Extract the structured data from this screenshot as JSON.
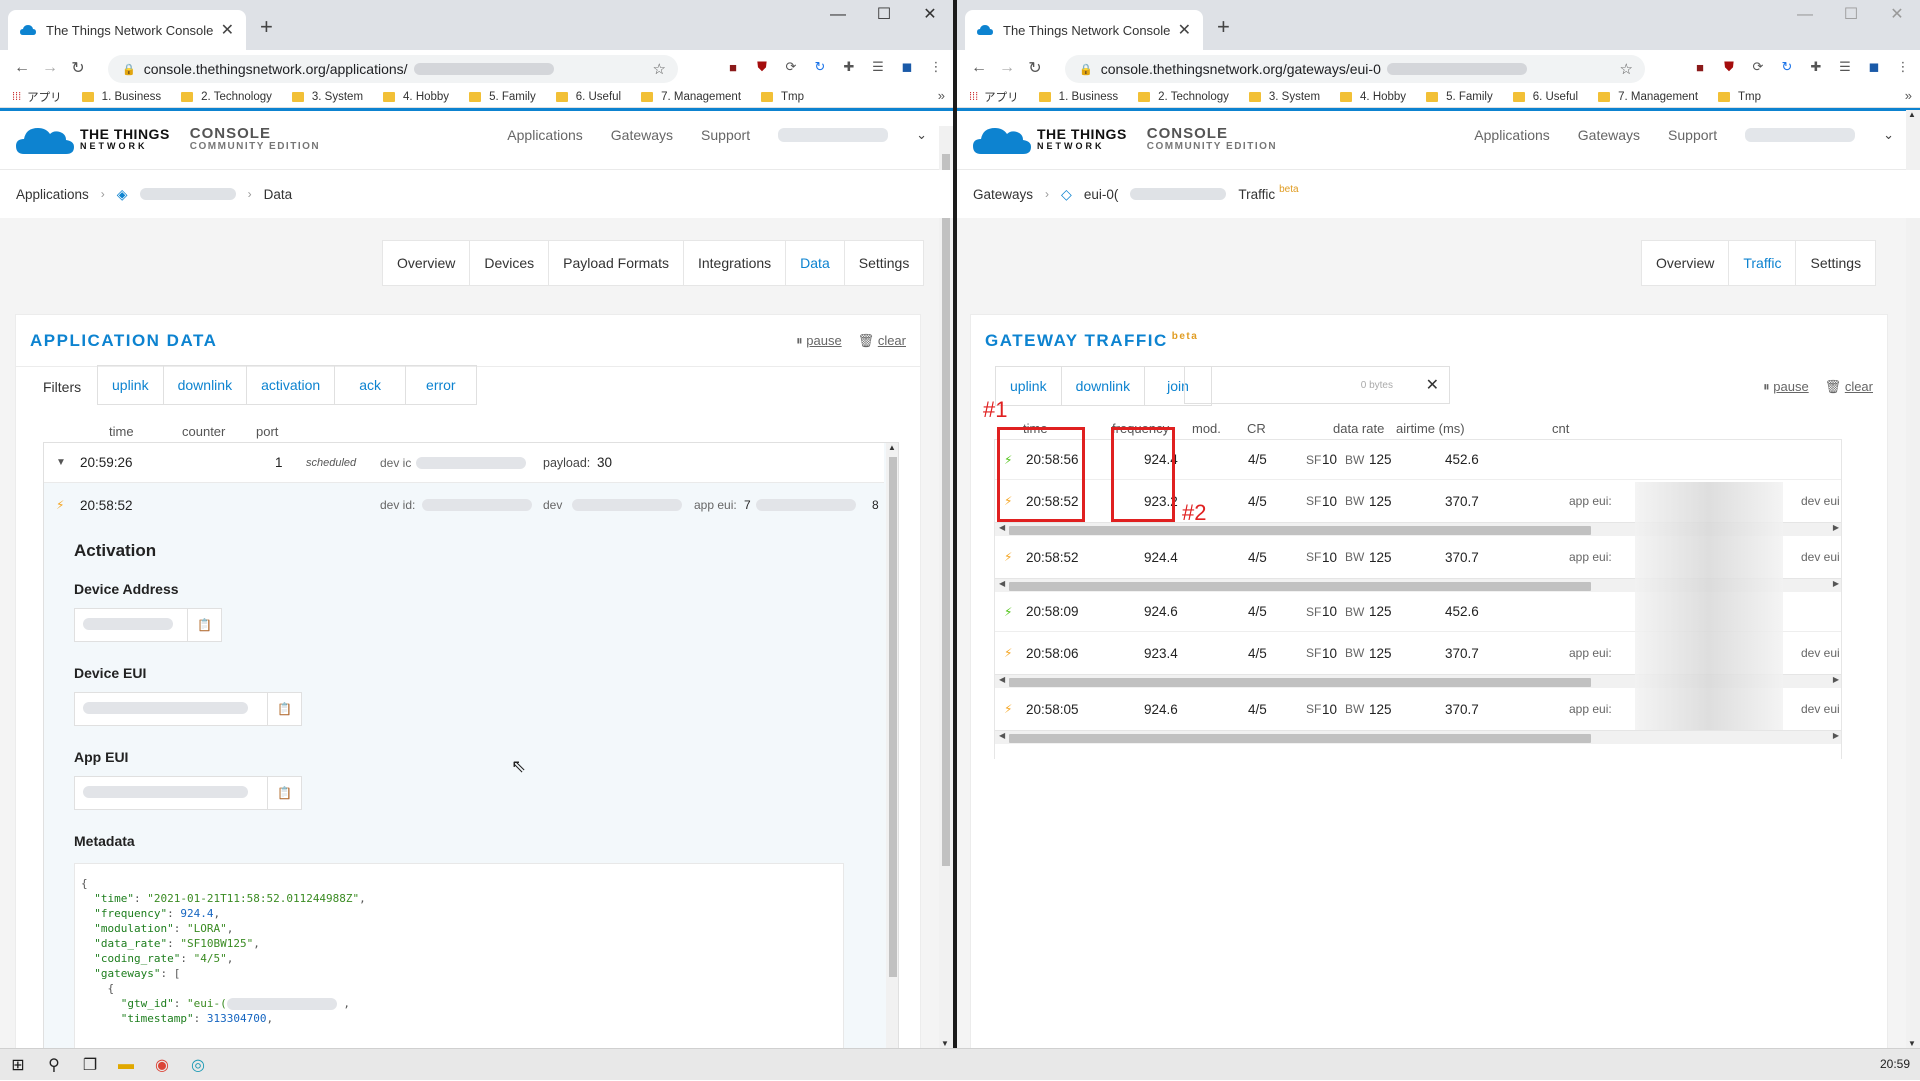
{
  "browser": {
    "tab_title": "The Things Network Console",
    "new_tab": "+",
    "bookmarks": [
      {
        "label": "アプリ",
        "type": "apps"
      },
      {
        "label": "1. Business"
      },
      {
        "label": "2. Technology"
      },
      {
        "label": "3. System"
      },
      {
        "label": "4. Hobby"
      },
      {
        "label": "5. Family"
      },
      {
        "label": "6. Useful"
      },
      {
        "label": "7. Management"
      },
      {
        "label": "Tmp"
      }
    ],
    "bookmark_more": "»"
  },
  "left": {
    "url": "console.thethingsnetwork.org/applications/",
    "header": {
      "logo_line1": "THE THINGS",
      "logo_line2": "NETWORK",
      "console_line1": "CONSOLE",
      "console_line2": "COMMUNITY EDITION",
      "nav": [
        "Applications",
        "Gateways",
        "Support"
      ]
    },
    "breadcrumb": [
      "Applications",
      "Data"
    ],
    "subtabs": [
      "Overview",
      "Devices",
      "Payload Formats",
      "Integrations",
      "Data",
      "Settings"
    ],
    "active_subtab": "Data",
    "panel_title": "APPLICATION DATA",
    "actions": {
      "pause": "pause",
      "clear": "clear"
    },
    "filters_label": "Filters",
    "filters": [
      "uplink",
      "downlink",
      "activation",
      "ack",
      "error"
    ],
    "columns": [
      "time",
      "counter",
      "port"
    ],
    "rows": [
      {
        "time": "20:59:26",
        "counter": "1",
        "status": "scheduled",
        "dev_label": "dev ic",
        "payload_label": "payload:",
        "payload": "30"
      },
      {
        "time": "20:58:52",
        "dev_id_label": "dev id:",
        "dev_label": "dev",
        "app_eui_label": "app eui:",
        "app_eui_start": "7",
        "tail": "8"
      }
    ],
    "activation": {
      "title": "Activation",
      "device_address": "Device Address",
      "device_eui": "Device EUI",
      "app_eui": "App EUI",
      "metadata": "Metadata"
    },
    "metadata_json": {
      "open": "{",
      "time_key": "\"time\"",
      "time_val": "\"2021-01-21T11:58:52.011244988Z\"",
      "freq_key": "\"frequency\"",
      "freq_val": "924.4",
      "mod_key": "\"modulation\"",
      "mod_val": "\"LORA\"",
      "dr_key": "\"data_rate\"",
      "dr_val": "\"SF10BW125\"",
      "cr_key": "\"coding_rate\"",
      "cr_val": "\"4/5\"",
      "gw_key": "\"gateways\"",
      "gw_open": "[",
      "obj_open": "{",
      "gtw_key": "\"gtw_id\"",
      "gtw_val": "\"eui-(",
      "ts_key": "\"timestamp\"",
      "ts_val": "313304700"
    }
  },
  "right": {
    "url": "console.thethingsnetwork.org/gateways/eui-0",
    "header": {
      "logo_line1": "THE THINGS",
      "logo_line2": "NETWORK",
      "console_line1": "CONSOLE",
      "console_line2": "COMMUNITY EDITION",
      "nav": [
        "Applications",
        "Gateways",
        "Support"
      ]
    },
    "breadcrumb": [
      "Gateways",
      "eui-0(",
      "Traffic"
    ],
    "beta": "beta",
    "subtabs": [
      "Overview",
      "Traffic",
      "Settings"
    ],
    "active_subtab": "Traffic",
    "panel_title": "GATEWAY TRAFFIC",
    "actions": {
      "pause": "pause",
      "clear": "clear"
    },
    "filters": [
      "uplink",
      "downlink",
      "join"
    ],
    "search_bytes": "0 bytes",
    "search_clear": "✕",
    "columns": [
      "time",
      "frequency",
      "mod.",
      "CR",
      "data rate",
      "airtime (ms)",
      "cnt"
    ],
    "rows": [
      {
        "type": "up",
        "time": "20:58:56",
        "freq": "924.4",
        "cr": "4/5",
        "sf": "SF",
        "sfv": "10",
        "bw": "BW",
        "bwv": "125",
        "airtime": "452.6",
        "app_eui": "",
        "dev_eui": ""
      },
      {
        "type": "up",
        "time": "20:58:52",
        "freq": "923.2",
        "cr": "4/5",
        "sf": "SF",
        "sfv": "10",
        "bw": "BW",
        "bwv": "125",
        "airtime": "370.7",
        "app_eui": "app eui:",
        "dev_eui": "dev eui"
      },
      {
        "type": "up",
        "time": "20:58:52",
        "freq": "924.4",
        "cr": "4/5",
        "sf": "SF",
        "sfv": "10",
        "bw": "BW",
        "bwv": "125",
        "airtime": "370.7",
        "app_eui": "app eui:",
        "dev_eui": "dev eui"
      },
      {
        "type": "up",
        "time": "20:58:09",
        "freq": "924.6",
        "cr": "4/5",
        "sf": "SF",
        "sfv": "10",
        "bw": "BW",
        "bwv": "125",
        "airtime": "452.6",
        "app_eui": "",
        "dev_eui": ""
      },
      {
        "type": "up",
        "time": "20:58:06",
        "freq": "923.4",
        "cr": "4/5",
        "sf": "SF",
        "sfv": "10",
        "bw": "BW",
        "bwv": "125",
        "airtime": "370.7",
        "app_eui": "app eui:",
        "dev_eui": "dev eui"
      },
      {
        "type": "up",
        "time": "20:58:05",
        "freq": "924.6",
        "cr": "4/5",
        "sf": "SF",
        "sfv": "10",
        "bw": "BW",
        "bwv": "125",
        "airtime": "370.7",
        "app_eui": "app eui:",
        "dev_eui": "dev eui"
      }
    ],
    "annotations": [
      "#1",
      "#2"
    ]
  },
  "taskbar": {
    "clock": "20:59"
  },
  "colors": {
    "accent": "#0d83d0",
    "beta": "#e09c22",
    "annotation": "#e02020",
    "uplink_bolt": "#52c41a",
    "downlink_bolt": "#f5a623"
  }
}
